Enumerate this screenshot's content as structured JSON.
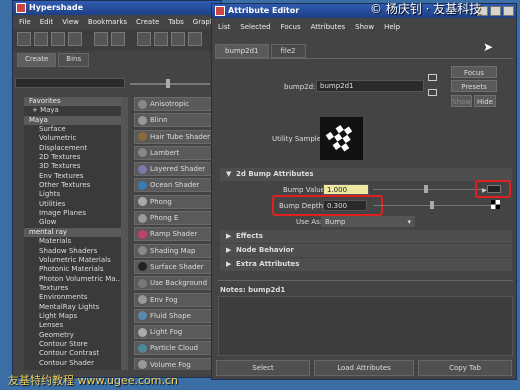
{
  "hypershade": {
    "title": "Hypershade",
    "menu": [
      "File",
      "Edit",
      "View",
      "Bookmarks",
      "Create",
      "Tabs",
      "Graph"
    ],
    "tabs": [
      "Create",
      "Bins"
    ],
    "tree": [
      {
        "t": "Favorites",
        "k": "grp"
      },
      {
        "t": "+ Maya",
        "k": "sub"
      },
      {
        "t": "Maya",
        "k": "grp"
      },
      {
        "t": "Surface"
      },
      {
        "t": "Volumetric"
      },
      {
        "t": "Displacement"
      },
      {
        "t": "2D Textures"
      },
      {
        "t": "3D Textures"
      },
      {
        "t": "Env Textures"
      },
      {
        "t": "Other Textures"
      },
      {
        "t": "Lights"
      },
      {
        "t": "Utilities"
      },
      {
        "t": "Image Planes"
      },
      {
        "t": "Glow"
      },
      {
        "t": "mental ray",
        "k": "grp"
      },
      {
        "t": "Materials"
      },
      {
        "t": "Shadow Shaders"
      },
      {
        "t": "Volumetric Materials"
      },
      {
        "t": "Photonic Materials"
      },
      {
        "t": "Photon Volumetric Ma..."
      },
      {
        "t": "Textures"
      },
      {
        "t": "Environments"
      },
      {
        "t": "MentalRay Lights"
      },
      {
        "t": "Light Maps"
      },
      {
        "t": "Lenses"
      },
      {
        "t": "Geometry"
      },
      {
        "t": "Contour Store"
      },
      {
        "t": "Contour Contrast"
      },
      {
        "t": "Contour Shader"
      }
    ],
    "nodes": [
      {
        "t": "Anisotropic",
        "c": "#888"
      },
      {
        "t": "Blinn",
        "c": "#999"
      },
      {
        "t": "Hair Tube Shader",
        "c": "#8a6a3a"
      },
      {
        "t": "Lambert",
        "c": "#888"
      },
      {
        "t": "Layered Shader",
        "c": "#7a7aaa"
      },
      {
        "t": "Ocean Shader",
        "c": "#3a7ab0"
      },
      {
        "t": "Phong",
        "c": "#aaa"
      },
      {
        "t": "Phong E",
        "c": "#999"
      },
      {
        "t": "Ramp Shader",
        "c": "#c04070"
      },
      {
        "t": "Shading Map",
        "c": "#888"
      },
      {
        "t": "Surface Shader",
        "c": "#222"
      },
      {
        "t": "Use Background",
        "c": "#777"
      },
      {
        "t": "Env Fog",
        "c": "#999"
      },
      {
        "t": "Fluid Shape",
        "c": "#5a8aaa"
      },
      {
        "t": "Light Fog",
        "c": "#aaa"
      },
      {
        "t": "Particle Cloud",
        "c": "#4a8a9a"
      },
      {
        "t": "Volume Fog",
        "c": "#999"
      }
    ]
  },
  "ae": {
    "title": "Attribute Editor",
    "menu": [
      "List",
      "Selected",
      "Focus",
      "Attributes",
      "Show",
      "Help"
    ],
    "tabs": [
      "bump2d1",
      "file2"
    ],
    "node_label": "bump2d:",
    "node_value": "bump2d1",
    "focus": "Focus",
    "presets": "Presets",
    "show": "Show",
    "hide": "Hide",
    "sample_label": "Utility Sample",
    "section_2d": "2d Bump Attributes",
    "bump_value_label": "Bump Value",
    "bump_value": "1.000",
    "bump_depth_label": "Bump Depth",
    "bump_depth": "0.300",
    "use_as_label": "Use As:",
    "use_as": "Bump",
    "sections": [
      "Effects",
      "Node Behavior",
      "Extra Attributes"
    ],
    "notes": "Notes: bump2d1",
    "buttons": [
      "Select",
      "Load Attributes",
      "Copy Tab"
    ]
  },
  "watermark_top": "© 杨庆钊 · 友基科技",
  "watermark_bottom": "友基特约教程 www.ugee.com.cn"
}
